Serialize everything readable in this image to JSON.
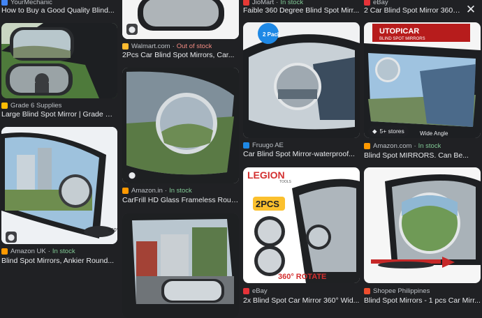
{
  "close_icon": "✕",
  "tag_icon": "tag-icon",
  "columns": [
    [
      {
        "source": "YourMechanic",
        "favicon_color": "#4285f4",
        "stock": "",
        "title": "How to Buy a Good Quality Blind..."
      },
      {
        "source": "Grade 6 Supplies",
        "favicon_color": "#fbbc04",
        "stock": "",
        "title": "Large Blind Spot Mirror | Grade Six..."
      },
      {
        "source": "Amazon UK",
        "favicon_color": "#ff9900",
        "stock": "In stock",
        "title": "Blind Spot Mirrors, Ankier Round..."
      }
    ],
    [
      {
        "source": "Walmart.com",
        "favicon_color": "#fdbb30",
        "stock": "Out of stock",
        "stock_kind": "oos",
        "title": "2Pcs Car Blind Spot Mirrors, Car..."
      },
      {
        "source": "Amazon.in",
        "favicon_color": "#ff9900",
        "stock": "In stock",
        "title": "CarFrill HD Glass Frameless Roun..."
      },
      {
        "source": "",
        "favicon_color": "",
        "stock": "",
        "title": ""
      }
    ],
    [
      {
        "source": "JioMart",
        "favicon_color": "#e53935",
        "stock": "In stock",
        "title": "Faible 360 Degree Blind Spot Mirr..."
      },
      {
        "source": "Fruugo AE",
        "favicon_color": "#1e88e5",
        "stock": "",
        "title": "Car Blind Spot Mirror-waterproof..."
      },
      {
        "source": "eBay",
        "favicon_color": "#e53238",
        "stock": "",
        "title": "2x Blind Spot Car Mirror 360° Wid..."
      }
    ],
    [
      {
        "source": "eBay",
        "favicon_color": "#e53238",
        "stock": "",
        "title": "2 Car Blind Spot Mirror 360°..."
      },
      {
        "source": "Amazon.com",
        "favicon_color": "#ff9900",
        "stock": "In stock",
        "title": "Blind Spot MIRRORS. Can Be..."
      },
      {
        "source": "Shopee Philippines",
        "favicon_color": "#ee4d2d",
        "stock": "",
        "title": "Blind Spot Mirrors - 1 pcs Car Mirr..."
      }
    ]
  ],
  "overlays": {
    "pack_badge": "2 Pack",
    "legion_brand": "LEGION",
    "legion_sub": "TOOLS",
    "pcs_label": "2PCS",
    "rotate_label": "360° ROTATE",
    "utopicar_brand": "UTOPICAR",
    "utopicar_sub": "BLIND SPOT MIRRORS",
    "wide_angle": "Wide Angle",
    "stores_label": "5+ stores",
    "deg_label": "360°"
  },
  "separator": "·"
}
